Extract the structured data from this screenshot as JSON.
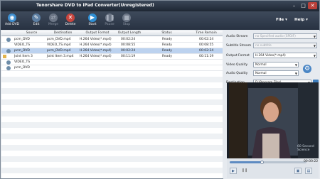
{
  "window": {
    "title": "Tenorshare DVD to iPad Converter(Unregistered)"
  },
  "toolbar": {
    "add_dvd": "Add DVD",
    "edit": "Edit",
    "merge": "Merge",
    "delete": "Delete",
    "start": "Start",
    "pause": "Pause",
    "stop": "Stop",
    "file_menu": "File",
    "help_menu": "Help"
  },
  "table": {
    "columns": [
      "Source",
      "Destination",
      "Output Format",
      "Output Length",
      "Status",
      "Time Remain"
    ],
    "rows": [
      {
        "source": "pcm_DVD",
        "destination": "pcm_DVD.mp4",
        "format": "H.264 Video(*.mp4)",
        "length": "00:02:24",
        "status": "Ready",
        "remain": "00:02:24"
      },
      {
        "source": "VIDEO_TS",
        "destination": "VIDEO_TS.mp4",
        "format": "H.264 Video(*.mp4)",
        "length": "00:08:55",
        "status": "Ready",
        "remain": "00:08:55"
      },
      {
        "source": "pcm_DVD",
        "destination": "pcm_DVD.mp4",
        "format": "H.264 Video(*.mp4)",
        "length": "00:02:24",
        "status": "Ready",
        "remain": "00:02:24"
      },
      {
        "source": "Joint Item 3",
        "destination": "Joint Item 3.mp4",
        "format": "H.264 Video(*.mp4)",
        "length": "00:11:19",
        "status": "Ready",
        "remain": "00:11:19"
      },
      {
        "source": "VIDEO_TS",
        "destination": "",
        "format": "",
        "length": "",
        "status": "",
        "remain": ""
      },
      {
        "source": "pcm_DVD",
        "destination": "",
        "format": "",
        "length": "",
        "status": "",
        "remain": ""
      }
    ]
  },
  "settings": {
    "audio_stream": {
      "label": "Audio Stream",
      "value": "no Specified audio (SPDIF)"
    },
    "subtitle_stream": {
      "label": "Subtitle Stream",
      "value": "no subtitle"
    },
    "output_format": {
      "label": "Output Format",
      "value": "H.264 Video(*.mp4)"
    },
    "video_quality": {
      "label": "Video Quality",
      "value": "Normal"
    },
    "audio_quality": {
      "label": "Audio Quality",
      "value": "Normal"
    },
    "destination": {
      "label": "Destination",
      "value": "D:\\Program Files\\"
    }
  },
  "preview": {
    "watermark": "60 Second Science",
    "time": "00:00:22"
  },
  "colors": {
    "toolbar": "#2f3a4a",
    "selection": "#bcd2ef"
  }
}
